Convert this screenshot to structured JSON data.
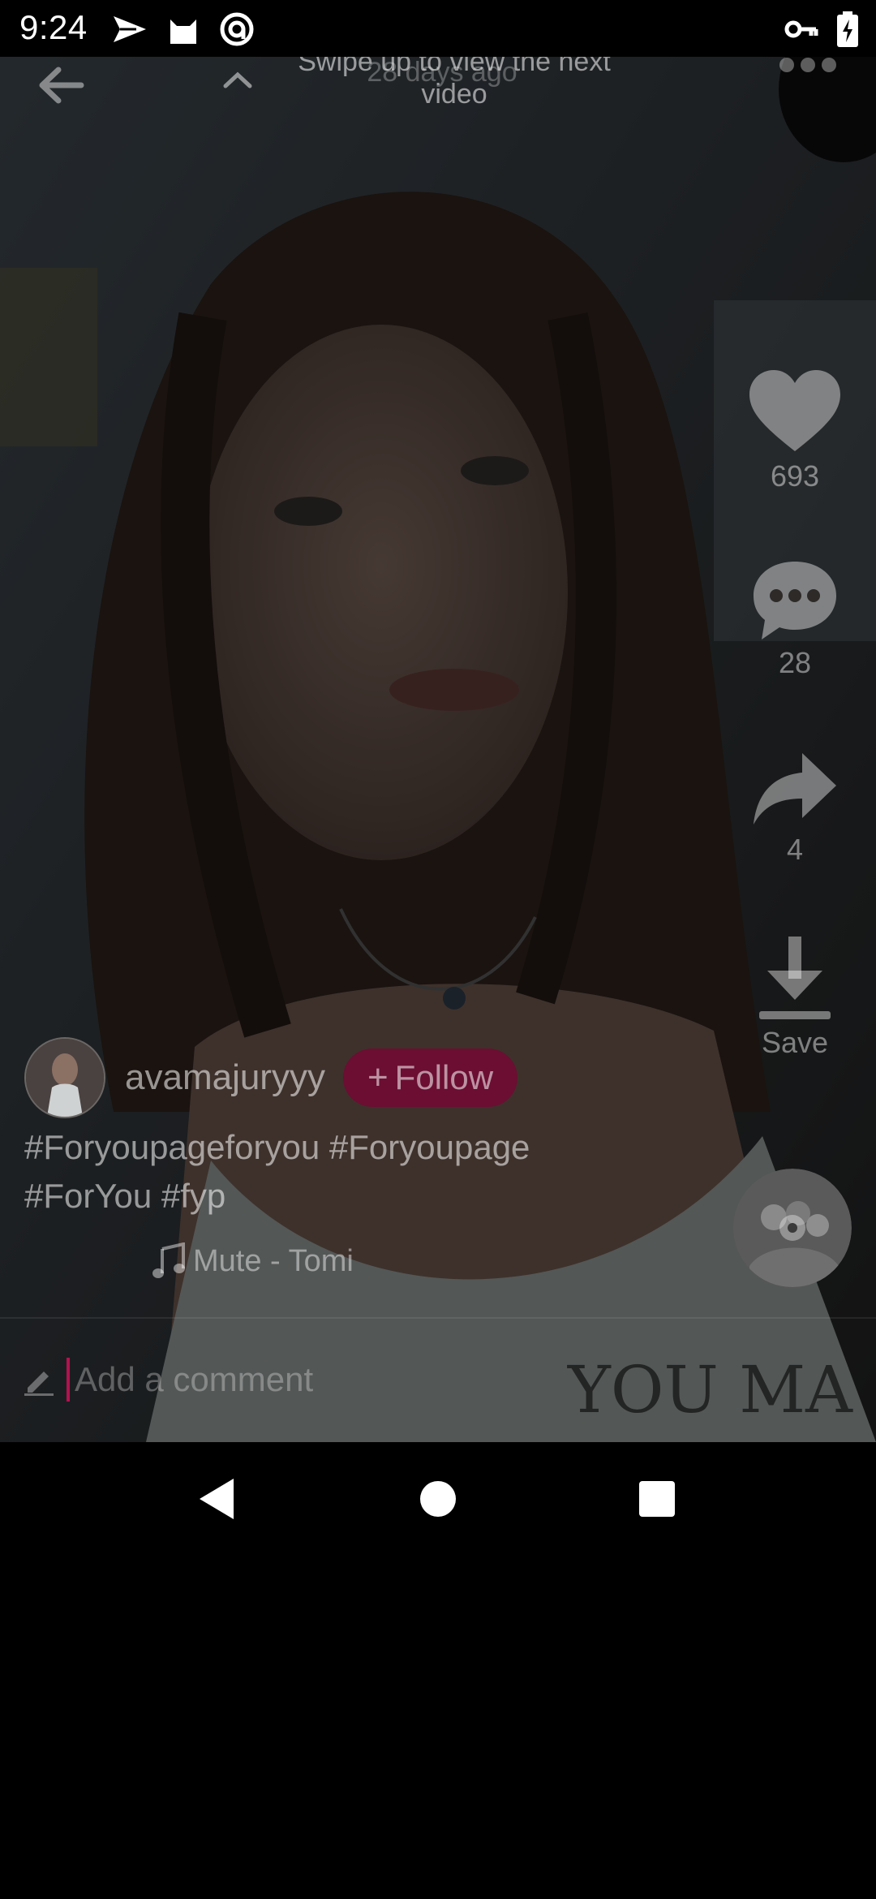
{
  "status_bar": {
    "time": "9:24",
    "left_icons": [
      "send-icon",
      "cat-icon",
      "at-icon"
    ],
    "right_icons": [
      "key-icon",
      "battery-charging-icon"
    ]
  },
  "top_overlay": {
    "swipe_hint": "Swipe up to view the next video",
    "posted_time": "28 days ago"
  },
  "actions": {
    "likes": "693",
    "comments": "28",
    "shares": "4",
    "save_label": "Save"
  },
  "author": {
    "username": "avamajuryyy",
    "follow_label": "Follow"
  },
  "caption": {
    "line1": "#Foryoupageforyou #Foryoupage",
    "line2": "#ForYou #fyp"
  },
  "music": {
    "title": "Mute - Tomi"
  },
  "comment_bar": {
    "placeholder": "Add a comment"
  },
  "colors": {
    "follow_bg": "#6b0e32",
    "caret": "#b3124f",
    "overlay": "rgba(0,0,0,0.55)"
  }
}
